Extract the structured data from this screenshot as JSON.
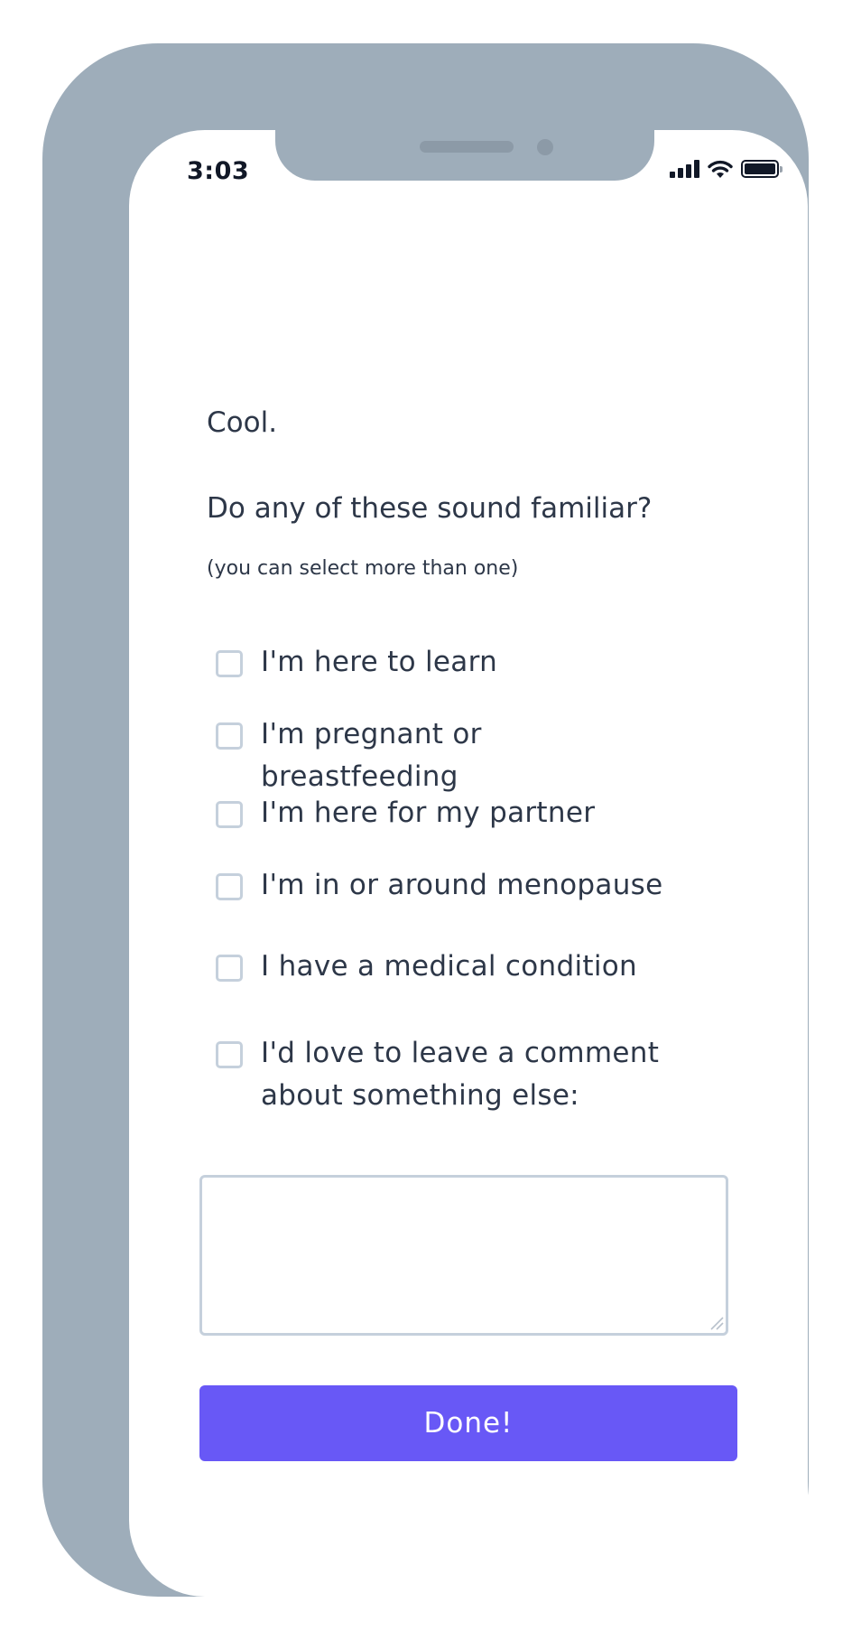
{
  "status_bar": {
    "time": "3:03",
    "icons": [
      "signal-icon",
      "wifi-icon",
      "battery-icon"
    ]
  },
  "survey": {
    "intro": "Cool.",
    "question": "Do any of these sound familiar?",
    "hint": "(you can select more than one)",
    "options": [
      {
        "label": "I'm here to learn",
        "checked": false
      },
      {
        "label": "I'm pregnant or breastfeeding",
        "checked": false
      },
      {
        "label": "I'm here for my partner",
        "checked": false
      },
      {
        "label": "I'm in or around menopause",
        "checked": false
      },
      {
        "label": "I have a medical condition",
        "checked": false
      },
      {
        "label": "I'd love to leave a comment about something else:",
        "checked": false
      }
    ],
    "comment": {
      "value": "",
      "placeholder": ""
    },
    "submit_label": "Done!"
  },
  "colors": {
    "frame": "#9eadba",
    "accent": "#6858f6",
    "text": "#2d3748",
    "checkbox_border": "#c5d0dc"
  }
}
